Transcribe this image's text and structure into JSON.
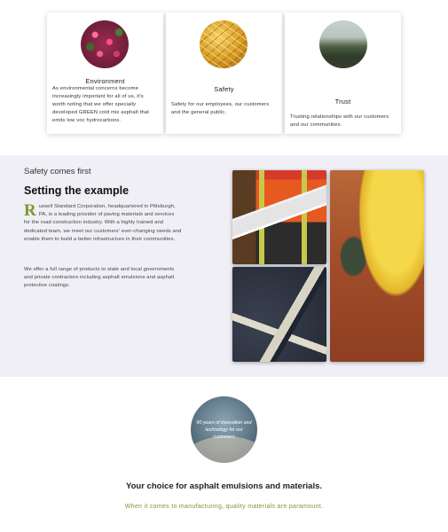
{
  "cards": [
    {
      "title": "Environment",
      "image_icon": "flowers-image",
      "body": "As environmental concerns become increasingly important for all of us, it's worth noting that we offer specially developed GREEN cold mix asphalt that emits low voc hydrocarbons."
    },
    {
      "title": "Safety",
      "image_icon": "gold-texture-image",
      "body": "Safety for our employees, our customers and the general public."
    },
    {
      "title": "Trust",
      "image_icon": "landscape-image",
      "body": "Trusting relationships with our customers and our communities."
    }
  ],
  "safety": {
    "eyebrow": "Safety comes first",
    "headline": "Setting the example",
    "dropcap": "R",
    "para1": "ussell Standard Corporation, headquartered in Pittsburgh, PA, is a leading provider of paving materials and services for the road construction industry. With a highly trained and dedicated team, we meet our customers' ever-changing needs and enable them to build a better infrastructure in their communities.",
    "para2": "We offer a full range of products to state and local governments and private contractors including asphalt emulsions and asphalt protective coatings.",
    "photos": [
      "worker-blueprints-photo",
      "asphalt-photo",
      "hard-hat-photo"
    ]
  },
  "bottom": {
    "badge_text": "90 years of innovation and technology for our customers",
    "choice": "Your choice for asphalt emulsions and materials.",
    "tagline": "When it comes to manufacturing, quality materials are paramount."
  },
  "colors": {
    "accent_green": "#7a9a2a",
    "section_bg": "#efeff5"
  }
}
